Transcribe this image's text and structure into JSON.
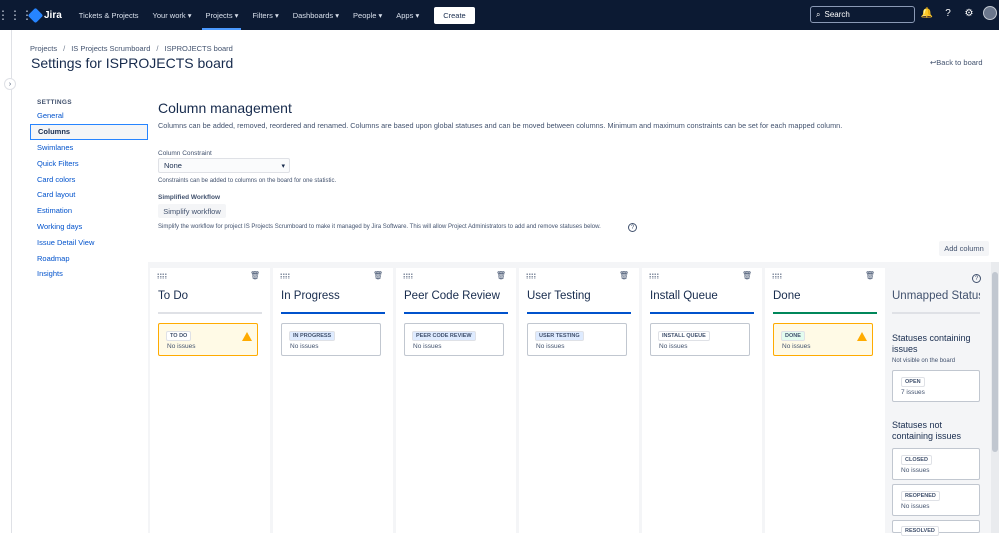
{
  "topbar": {
    "logo": "Jira",
    "project": "Tickets & Projects",
    "nav": [
      "Your work",
      "Projects",
      "Filters",
      "Dashboards",
      "People",
      "Apps"
    ],
    "create_label": "Create",
    "search_placeholder": "Search"
  },
  "breadcrumb": [
    "Projects",
    "IS Projects Scrumboard",
    "ISPROJECTS board"
  ],
  "page_title": "Settings for ISPROJECTS board",
  "back_link": "Back to board",
  "sidebar": {
    "heading": "SETTINGS",
    "items": [
      "General",
      "Columns",
      "Swimlanes",
      "Quick Filters",
      "Card colors",
      "Card layout",
      "Estimation",
      "Working days",
      "Issue Detail View",
      "Roadmap",
      "Insights"
    ],
    "active": "Columns"
  },
  "content": {
    "title": "Column management",
    "description": "Columns can be added, removed, reordered and renamed. Columns are based upon global statuses and can be moved between columns. Minimum and maximum constraints can be set for each mapped column.",
    "constraint_label": "Column Constraint",
    "constraint_value": "None",
    "constraint_hint": "Constraints can be added to columns on the board for one statistic.",
    "workflow_label": "Simplified Workflow",
    "workflow_button": "Simplify workflow",
    "workflow_hint": "Simplify the workflow for project IS Projects Scrumboard to make it managed by Jira Software. This will allow Project Administrators to add and remove statuses below.",
    "add_column": "Add column"
  },
  "columns": [
    {
      "name": "To Do",
      "status": "TO DO",
      "count": "No issues",
      "bar_color": "#dfe1e6",
      "warning": true
    },
    {
      "name": "In Progress",
      "status": "IN PROGRESS",
      "count": "No issues",
      "bar_color": "#0052cc",
      "warning": false
    },
    {
      "name": "Peer Code Review",
      "status": "PEER CODE REVIEW",
      "count": "No issues",
      "bar_color": "#0052cc",
      "warning": false
    },
    {
      "name": "User Testing",
      "status": "USER TESTING",
      "count": "No issues",
      "bar_color": "#0052cc",
      "warning": false
    },
    {
      "name": "Install Queue",
      "status": "INSTALL QUEUE",
      "count": "No issues",
      "bar_color": "#0052cc",
      "warning": false
    },
    {
      "name": "Done",
      "status": "DONE",
      "count": "No issues",
      "bar_color": "#00875a",
      "warning": true
    }
  ],
  "unmapped": {
    "title": "Unmapped Statuses",
    "containing_heading": "Statuses containing issues",
    "containing_sub": "Not visible on the board",
    "containing": [
      {
        "status": "OPEN",
        "count": "7 issues"
      }
    ],
    "not_containing_heading": "Statuses not containing issues",
    "not_containing": [
      {
        "status": "CLOSED",
        "count": "No issues"
      },
      {
        "status": "REOPENED",
        "count": "No issues"
      },
      {
        "status": "RESOLVED",
        "count": ""
      }
    ]
  }
}
